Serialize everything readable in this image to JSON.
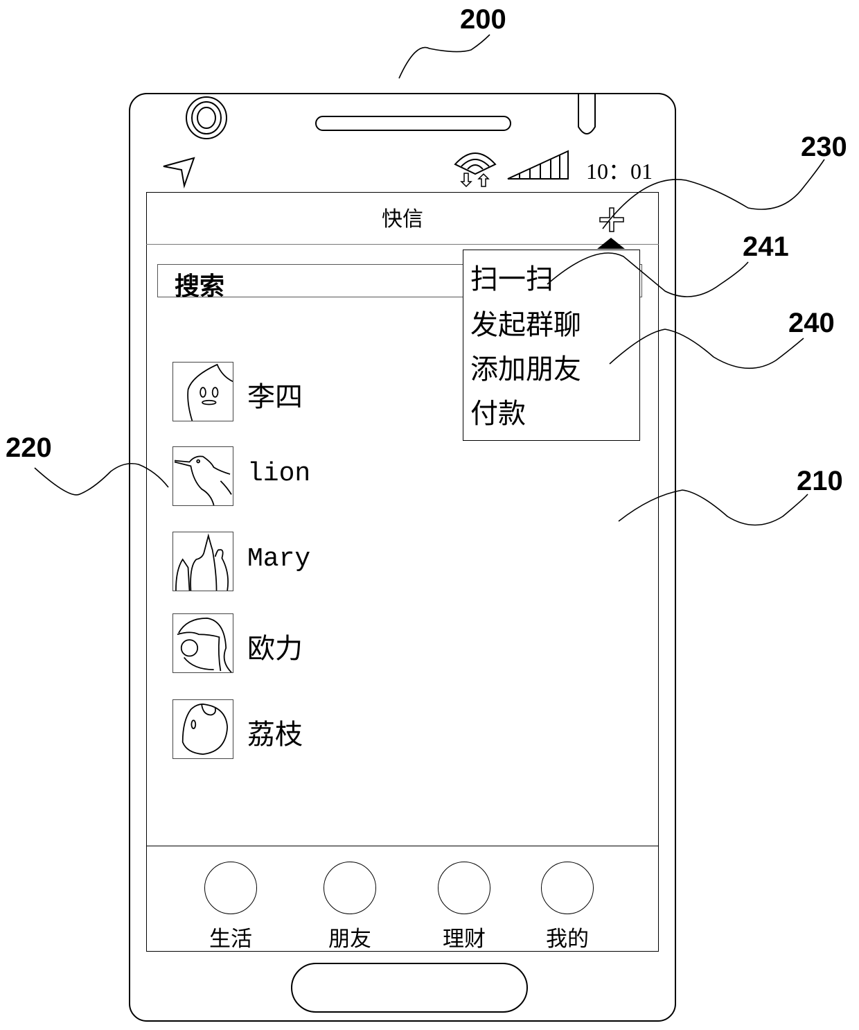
{
  "figure": {
    "reference_labels": {
      "device": "200",
      "screen": "210",
      "contact_item": "220",
      "add_button": "230",
      "popup_menu": "240",
      "menu_item": "241"
    }
  },
  "status_bar": {
    "icons": [
      "location-arrow-icon",
      "wifi-icon",
      "data-transfer-icon",
      "signal-strength-icon"
    ],
    "time": "10：01"
  },
  "app": {
    "title": "快信",
    "add_icon": "plus-icon"
  },
  "search": {
    "placeholder": "搜索"
  },
  "contacts": [
    {
      "name": "李四",
      "avatar": "ghost-avatar"
    },
    {
      "name": "lion",
      "avatar": "bird-avatar"
    },
    {
      "name": "Mary",
      "avatar": "flames-avatar"
    },
    {
      "name": "欧力",
      "avatar": "swirl-avatar"
    },
    {
      "name": "荔枝",
      "avatar": "lychee-avatar"
    }
  ],
  "popup_menu": {
    "items": [
      {
        "label": "扫一扫"
      },
      {
        "label": "发起群聊"
      },
      {
        "label": "添加朋友"
      },
      {
        "label": "付款"
      }
    ]
  },
  "tab_bar": {
    "tabs": [
      {
        "label": "生活"
      },
      {
        "label": "朋友"
      },
      {
        "label": "理财"
      },
      {
        "label": "我的"
      }
    ]
  }
}
